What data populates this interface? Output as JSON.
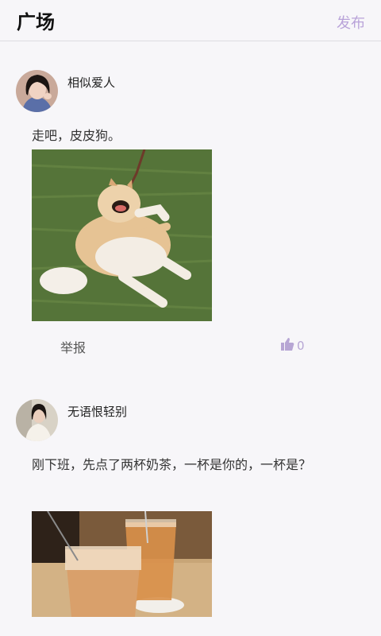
{
  "header": {
    "title": "广场",
    "publish_label": "发布"
  },
  "posts": [
    {
      "username": "相似爱人",
      "content": "走吧，皮皮狗。",
      "report_label": "举报",
      "like_count": "0"
    },
    {
      "username": "无语恨轻别",
      "content": "刚下班，先点了两杯奶茶，一杯是你的，一杯是？"
    }
  ],
  "colors": {
    "accent": "#b9a3d9",
    "background": "#f7f6f9"
  },
  "icons": {
    "like": "thumbs-up-icon"
  }
}
